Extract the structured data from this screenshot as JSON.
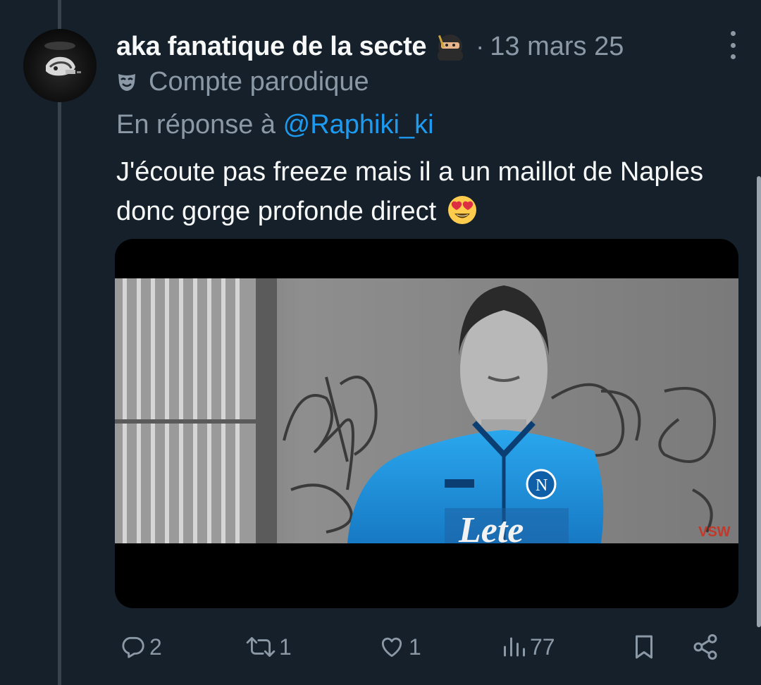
{
  "tweet": {
    "author_name": "aka fanatique de la secte",
    "separator": "·",
    "date": "13 mars 25",
    "parody_label": "Compte parodique",
    "reply_prefix": "En réponse à",
    "reply_mention": "@Raphiki_ki",
    "text": "J'écoute pas freeze mais il a un maillot de Naples donc gorge profonde direct"
  },
  "media": {
    "jersey_text": "Lete",
    "watermark": "VSW"
  },
  "actions": {
    "replies": "2",
    "reposts": "1",
    "likes": "1",
    "views": "77"
  },
  "icons": {
    "author_badge": "ninja-emoji-icon",
    "parody": "mask-icon",
    "text_emoji": "heart-eyes-emoji-icon",
    "more": "more-icon",
    "reply": "reply-icon",
    "repost": "repost-icon",
    "like": "heart-icon",
    "views": "views-icon",
    "bookmark": "bookmark-icon",
    "share": "share-icon"
  },
  "colors": {
    "background": "#15202b",
    "text": "#f7f9f9",
    "muted": "#8b98a5",
    "mention": "#1d9bf0",
    "jersey": "#1a8fd8"
  }
}
